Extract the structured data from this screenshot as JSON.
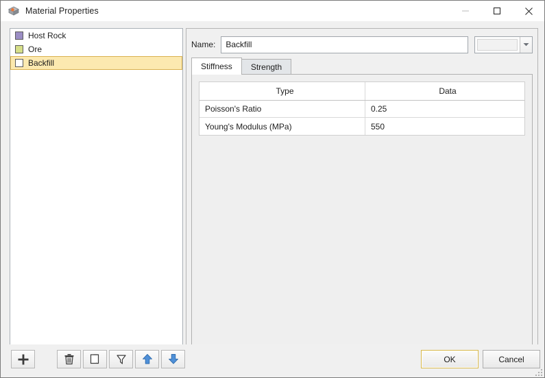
{
  "window": {
    "title": "Material Properties",
    "icon": "material-cube-icon",
    "controls": {
      "minimize": "minimize-icon",
      "maximize": "maximize-icon",
      "close": "close-icon"
    }
  },
  "material_list": {
    "items": [
      {
        "label": "Host Rock",
        "color": "#9b8ec4",
        "selected": false
      },
      {
        "label": "Ore",
        "color": "#d6df89",
        "selected": false
      },
      {
        "label": "Backfill",
        "color": "#ffffff",
        "selected": true
      }
    ],
    "selection_bg": "#fce9b0",
    "selection_border": "#d9b14e"
  },
  "detail": {
    "name_label": "Name:",
    "name_value": "Backfill",
    "name_placeholder": "Name",
    "color_value": "#f2f2f2",
    "tabs": [
      {
        "label": "Stiffness",
        "active": true
      },
      {
        "label": "Strength",
        "active": false
      }
    ],
    "grid": {
      "headers": [
        "Type",
        "Data"
      ],
      "rows": [
        {
          "type": "Poisson's Ratio",
          "data": "0.25"
        },
        {
          "type": "Young's Modulus (MPa)",
          "data": "550"
        }
      ]
    }
  },
  "toolbar": {
    "add": {
      "name": "add-material-button",
      "icon": "plus-icon"
    },
    "delete": {
      "name": "delete-material-button",
      "icon": "trash-icon"
    },
    "duplicate": {
      "name": "duplicate-material-button",
      "icon": "copy-icon"
    },
    "filter": {
      "name": "filter-button",
      "icon": "funnel-icon"
    },
    "move_up": {
      "name": "move-up-button",
      "icon": "arrow-up-icon"
    },
    "move_down": {
      "name": "move-down-button",
      "icon": "arrow-down-icon"
    },
    "arrow_color": "#4f90d8"
  },
  "dialog_buttons": {
    "ok": "OK",
    "cancel": "Cancel"
  }
}
